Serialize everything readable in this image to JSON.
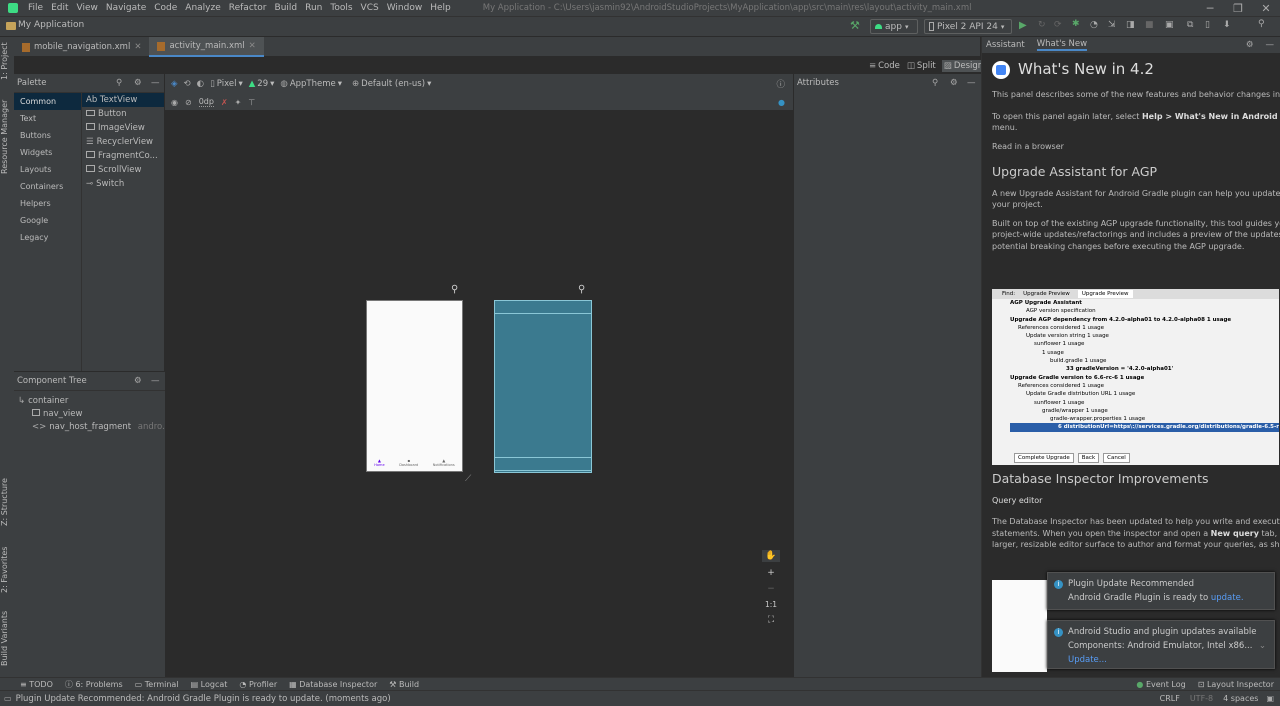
{
  "menu": [
    "File",
    "Edit",
    "View",
    "Navigate",
    "Code",
    "Analyze",
    "Refactor",
    "Build",
    "Run",
    "Tools",
    "VCS",
    "Window",
    "Help"
  ],
  "window_title": "My Application - C:\\Users\\jasmin92\\AndroidStudioProjects\\MyApplication\\app\\src\\main\\res\\layout\\activity_main.xml",
  "project_name": "My Application",
  "toolbar": {
    "run_config": "app",
    "device": "Pixel 2 API 24"
  },
  "editor_tabs": [
    "mobile_navigation.xml",
    "activity_main.xml"
  ],
  "view_modes": [
    "Code",
    "Split",
    "Design"
  ],
  "side_tabs": {
    "project": "1: Project",
    "resource_manager": "Resource Manager",
    "structure": "Z: Structure",
    "favorites": "2: Favorites",
    "build_variants": "Build Variants"
  },
  "palette": {
    "title": "Palette",
    "categories": [
      "Common",
      "Text",
      "Buttons",
      "Widgets",
      "Layouts",
      "Containers",
      "Helpers",
      "Google",
      "Legacy"
    ],
    "items": [
      "Ab TextView",
      "Button",
      "ImageView",
      "RecyclerView",
      "FragmentCo...",
      "ScrollView",
      "Switch"
    ]
  },
  "design_toolbar": {
    "device": "Pixel",
    "api": "29",
    "theme": "AppTheme",
    "locale": "Default (en-us)",
    "margin": "0dp"
  },
  "component_tree": {
    "title": "Component Tree",
    "items": [
      "container",
      "nav_view",
      "nav_host_fragment"
    ],
    "hint": "andro..."
  },
  "attributes": {
    "title": "Attributes"
  },
  "zoom": {
    "label": "1:1"
  },
  "phone_nav": [
    "Home",
    "Dashboard",
    "Notifications"
  ],
  "right_panel": {
    "tabs": [
      "Assistant",
      "What's New"
    ],
    "header": "What's New in 4.2",
    "intro": "This panel describes some of the new features and behavior changes included i",
    "open_line1": "To open this panel again later, select ",
    "open_bold": "Help > What's New in Android Studio",
    "open_line2": "menu.",
    "browser": "Read in a browser",
    "section1": "Upgrade Assistant for AGP",
    "s1p1a": "A new Upgrade Assistant for Android Gradle plugin can help you update the A",
    "s1p1b": "your project.",
    "s1p2a": "Built on top of the existing AGP upgrade functionality, this tool guides you thr",
    "s1p2b": "project-wide updates/refactorings and includes a preview of the updates to hel",
    "s1p2c": "potential breaking changes before executing the AGP upgrade.",
    "section2": "Database Inspector Improvements",
    "subhead": "Query editor",
    "s2p1a": "The Database Inspector has been updated to help you write and execute your c",
    "s2p1b_a": "statements. When you open the inspector and open a ",
    "s2p1b_bold": "New query",
    "s2p1b_b": " tab, you sho",
    "s2p1c": "larger, resizable editor surface to author and format your queries, as shown bel"
  },
  "screenshot": {
    "tabs": [
      "Find:",
      "Upgrade Preview",
      "Upgrade Preview"
    ],
    "lines": [
      "AGP Upgrade Assistant",
      "AGP version specification",
      "Upgrade AGP dependency from 4.2.0-alpha01 to 4.2.0-alpha08  1 usage",
      "References considered  1 usage",
      "Update version string  1 usage",
      "sunflower  1 usage",
      "1 usage",
      "build.gradle  1 usage",
      "33  gradleVersion = '4.2.0-alpha01'",
      "Upgrade Gradle version to 6.6-rc-6  1 usage",
      "References considered  1 usage",
      "Update Gradle distribution URL  1 usage",
      "sunflower  1 usage",
      "gradle/wrapper  1 usage",
      "gradle-wrapper.properties  1 usage",
      "6  distributionUrl=https\\://services.gradle.org/distributions/gradle-6.5-r"
    ],
    "buttons": [
      "Complete Upgrade",
      "Back",
      "Cancel"
    ]
  },
  "notifications": [
    {
      "title": "Plugin Update Recommended",
      "body": "Android Gradle Plugin is ready to ",
      "link": "update."
    },
    {
      "title": "Android Studio and plugin updates available",
      "body": "Components: Android Emulator, Intel x86...",
      "link": "Update..."
    }
  ],
  "bottom_tabs": [
    "TODO",
    "6: Problems",
    "Terminal",
    "Logcat",
    "Profiler",
    "Database Inspector",
    "Build"
  ],
  "bottom_right_tabs": [
    "Event Log",
    "Layout Inspector"
  ],
  "status": {
    "message": "Plugin Update Recommended: Android Gradle Plugin is ready to update. (moments ago)",
    "crlf": "CRLF",
    "encoding": "UTF-8",
    "indent": "4 spaces"
  }
}
